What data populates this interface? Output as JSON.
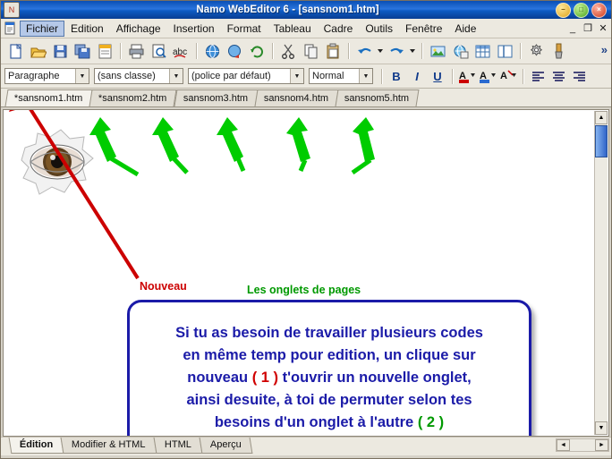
{
  "window": {
    "title": "Namo WebEditor 6 - [sansnom1.htm]",
    "sys_icon": "app-icon",
    "buttons": {
      "minimize": "–",
      "maximize": "□",
      "close": "×"
    }
  },
  "menubar": {
    "doc_icon": "document-icon",
    "items": [
      {
        "label": "Fichier",
        "selected": true
      },
      {
        "label": "Edition",
        "selected": false
      },
      {
        "label": "Affichage",
        "selected": false
      },
      {
        "label": "Insertion",
        "selected": false
      },
      {
        "label": "Format",
        "selected": false
      },
      {
        "label": "Tableau",
        "selected": false
      },
      {
        "label": "Cadre",
        "selected": false
      },
      {
        "label": "Outils",
        "selected": false
      },
      {
        "label": "Fenêtre",
        "selected": false
      },
      {
        "label": "Aide",
        "selected": false
      }
    ],
    "doc_controls": [
      {
        "name": "doc-minimize",
        "glyph": "_"
      },
      {
        "name": "doc-restore",
        "glyph": "❐"
      },
      {
        "name": "doc-close",
        "glyph": "✕"
      }
    ]
  },
  "toolbar": {
    "more_glyph": "»",
    "items": [
      {
        "name": "new-document",
        "tip": "Nouveau"
      },
      {
        "name": "open-document",
        "tip": "Ouvrir"
      },
      {
        "name": "save-document",
        "tip": "Enregistrer"
      },
      {
        "name": "save-all",
        "tip": "Tout enregistrer"
      },
      {
        "name": "new-from-template",
        "tip": "Modèle"
      },
      {
        "sep": true
      },
      {
        "name": "print",
        "tip": "Imprimer"
      },
      {
        "name": "print-preview",
        "tip": "Aperçu avant impression"
      },
      {
        "name": "spell-check",
        "tip": "Orthographe"
      },
      {
        "sep": true
      },
      {
        "name": "web-preview",
        "tip": "Aperçu navigateur"
      },
      {
        "name": "publish-site",
        "tip": "Publier"
      },
      {
        "name": "refresh",
        "tip": "Actualiser"
      },
      {
        "sep": true
      },
      {
        "name": "cut",
        "tip": "Couper"
      },
      {
        "name": "copy",
        "tip": "Copier"
      },
      {
        "name": "paste",
        "tip": "Coller"
      },
      {
        "sep": true
      },
      {
        "name": "undo",
        "tip": "Annuler"
      },
      {
        "name": "undo-dropdown",
        "tip": "Historique annuler"
      },
      {
        "name": "redo",
        "tip": "Rétablir"
      },
      {
        "name": "redo-dropdown",
        "tip": "Historique rétablir"
      },
      {
        "sep": true
      },
      {
        "name": "insert-image",
        "tip": "Insérer une image"
      },
      {
        "name": "insert-hyperlink",
        "tip": "Insérer un lien"
      },
      {
        "name": "insert-table",
        "tip": "Insérer un tableau"
      },
      {
        "name": "insert-frame",
        "tip": "Insérer un cadre"
      },
      {
        "sep": true
      },
      {
        "name": "properties",
        "tip": "Propriétés"
      },
      {
        "name": "format-painter",
        "tip": "Reproduire la mise en forme"
      }
    ]
  },
  "formatbar": {
    "paragraph_style": "Paragraphe",
    "class_style": "(sans classe)",
    "font_family": "(police par défaut)",
    "font_size": "Normal",
    "buttons": [
      {
        "name": "bold-button",
        "glyph": "B"
      },
      {
        "name": "italic-button",
        "glyph": "I"
      },
      {
        "name": "underline-button",
        "glyph": "U"
      },
      {
        "name": "font-color-button",
        "glyph": "A"
      },
      {
        "name": "highlight-color-button",
        "glyph": "A"
      },
      {
        "name": "clear-format-button",
        "glyph": "A"
      },
      {
        "name": "align-left-button",
        "glyph": "≡"
      },
      {
        "name": "align-center-button",
        "glyph": "≡"
      },
      {
        "name": "align-right-button",
        "glyph": "≡"
      }
    ]
  },
  "page_tabs": [
    {
      "label": "*sansnom1.htm",
      "active": true
    },
    {
      "label": "*sansnom2.htm",
      "active": false
    },
    {
      "label": "sansnom3.htm",
      "active": false
    },
    {
      "label": "sansnom4.htm",
      "active": false
    },
    {
      "label": "sansnom5.htm",
      "active": false
    }
  ],
  "document": {
    "eye_image": "eye-through-hole-image",
    "annotations": {
      "nouveau": "Nouveau",
      "onglets": "Les onglets de pages"
    },
    "callout": {
      "line1": "Si tu as besoin de travailler plusieurs codes",
      "line2": "en même temp pour edition, un clique sur",
      "line3_a": "nouveau ",
      "line3_num": "( 1 )",
      "line3_b": " t'ouvrir un nouvelle onglet,",
      "line4": "ainsi desuite, à toi de permuter selon tes",
      "line5_a": "besoins d'un onglet à l'autre ",
      "line5_num": "( 2 )"
    },
    "colors": {
      "callout_border": "#1b1ba8",
      "callout_text": "#1b1ba8",
      "red_arrow": "#cc0000",
      "green_arrow": "#00cc00",
      "red_label": "#cc0000",
      "green_label": "#009900"
    }
  },
  "view_tabs": [
    {
      "label": "Édition",
      "active": true
    },
    {
      "label": "Modifier & HTML",
      "active": false
    },
    {
      "label": "HTML",
      "active": false
    },
    {
      "label": "Aperçu",
      "active": false
    }
  ],
  "scrollbars": {
    "vertical": {
      "up": "▲",
      "down": "▼"
    },
    "horizontal": {
      "left": "◄",
      "right": "►"
    }
  }
}
